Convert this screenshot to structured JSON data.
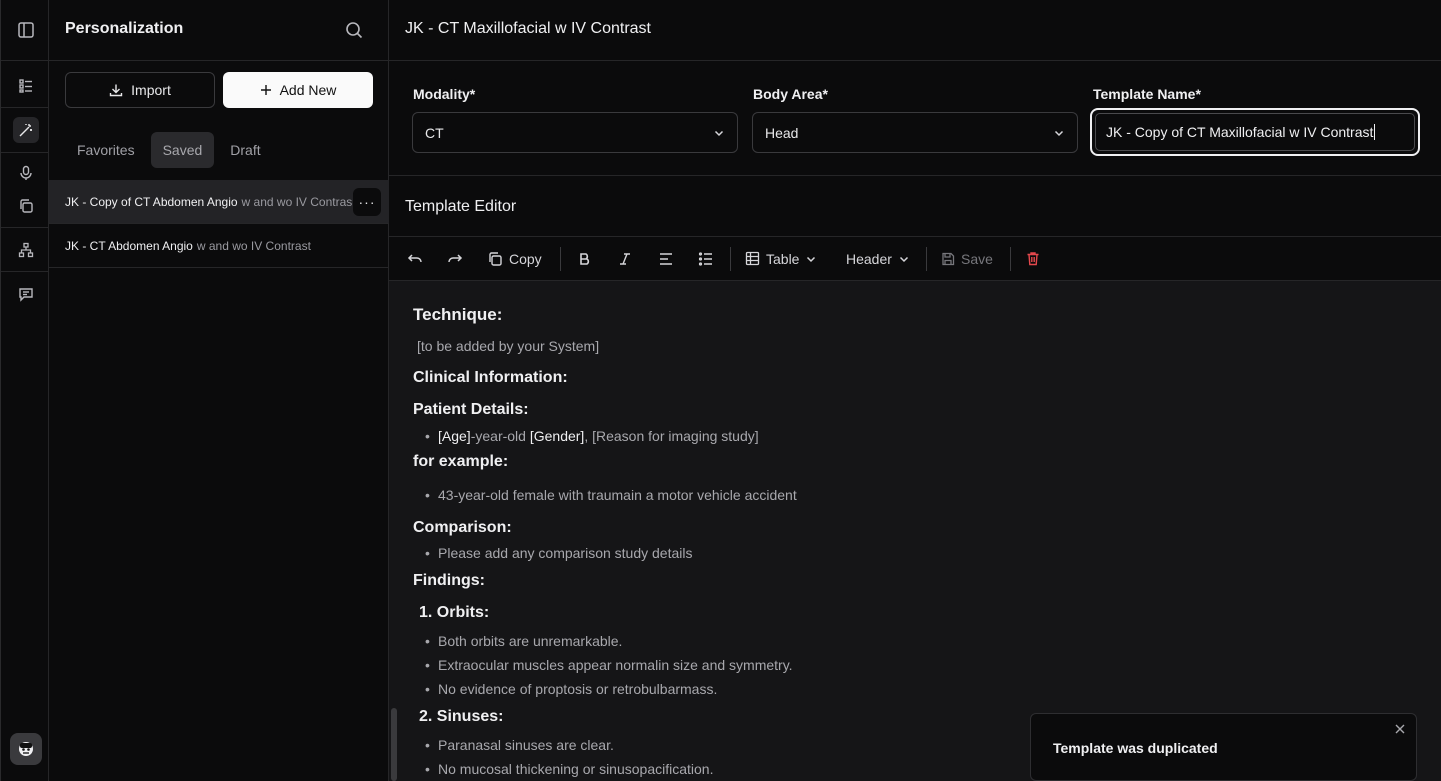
{
  "sidebar": {
    "title": "Personalization",
    "import_label": "Import",
    "add_new_label": "Add New",
    "tabs": [
      {
        "label": "Favorites"
      },
      {
        "label": "Saved"
      },
      {
        "label": "Draft"
      }
    ],
    "items": [
      {
        "name": "JK - Copy of CT Abdomen Angio",
        "suffix": "w and wo IV Contras"
      },
      {
        "name": "JK - CT Abdomen Angio",
        "suffix": "w and wo IV Contrast"
      }
    ],
    "more_label": "···"
  },
  "header": {
    "title": "JK - CT Maxillofacial w IV Contrast"
  },
  "form": {
    "modality_label": "Modality*",
    "modality_value": "CT",
    "body_area_label": "Body Area*",
    "body_area_value": "Head",
    "template_name_label": "Template Name*",
    "template_name_value": "JK - Copy of CT Maxillofacial w IV Contrast"
  },
  "editor": {
    "title": "Template Editor",
    "toolbar": {
      "copy_label": "Copy",
      "table_label": "Table",
      "header_label": "Header",
      "save_label": "Save"
    },
    "content": {
      "technique_heading": "Technique:",
      "technique_text": "[to be added by your System]",
      "clinical_heading": "Clinical Information:",
      "patient_heading": "Patient Details:",
      "patient_bullet": {
        "age": "[Age]",
        "mid1": "-year-old ",
        "gender": "[Gender]",
        "rest": ", [Reason for imaging study]"
      },
      "example_heading": "for example:",
      "example_bullet": "43-year-old female with traumain a motor vehicle accident",
      "comparison_heading": "Comparison:",
      "comparison_bullet": "Please add any comparison study details",
      "findings_heading": "Findings:",
      "orbits_heading": "1. Orbits:",
      "orbits_bullets": [
        "Both orbits are unremarkable.",
        "Extraocular muscles appear normalin size and symmetry.",
        "No evidence of proptosis or retrobulbarmass."
      ],
      "sinuses_heading": "2. Sinuses:",
      "sinuses_bullets": [
        "Paranasal sinuses are clear.",
        "No mucosal thickening or sinusopacification."
      ]
    }
  },
  "toast": {
    "message": "Template was duplicated"
  },
  "colors": {
    "danger": "#e5484d",
    "accent_white": "#fafafa"
  }
}
